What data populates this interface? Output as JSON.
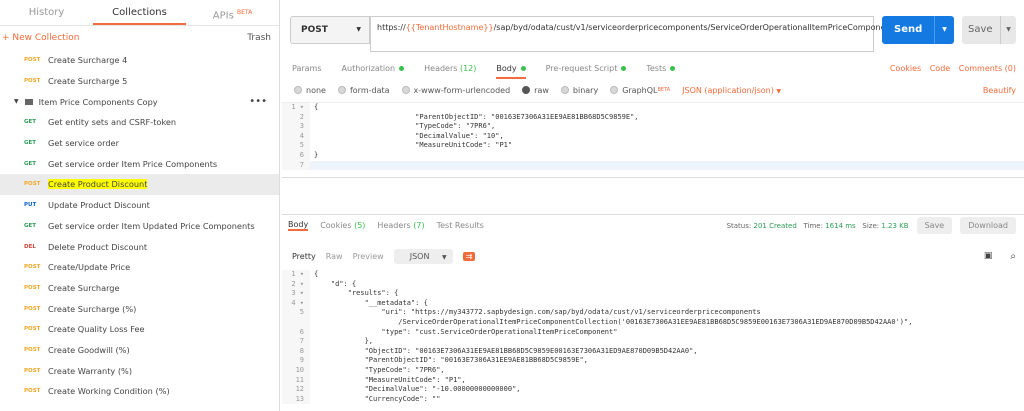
{
  "sidebar": {
    "tabs": [
      {
        "label": "History",
        "active": false
      },
      {
        "label": "Collections",
        "active": true
      },
      {
        "label": "APIs",
        "sup": "BETA",
        "active": false
      }
    ],
    "new_collection": "+ New Collection",
    "trash": "Trash",
    "items": [
      {
        "method": "POST",
        "label": "Create Surcharge 4"
      },
      {
        "method": "POST",
        "label": "Create Surcharge 5"
      },
      {
        "folder": true,
        "label": "Item Price Components Copy",
        "dots": "•••"
      },
      {
        "method": "GET",
        "label": "Get entity sets and CSRF-token"
      },
      {
        "method": "GET",
        "label": "Get service order"
      },
      {
        "method": "GET",
        "label": "Get service order Item Price Components"
      },
      {
        "method": "POST",
        "label": "Create Product Discount",
        "selected": true
      },
      {
        "method": "PUT",
        "label": "Update Product Discount"
      },
      {
        "method": "GET",
        "label": "Get service order Item Updated Price Components"
      },
      {
        "method": "DEL",
        "label": "Delete Product Discount"
      },
      {
        "method": "POST",
        "label": "Create/Update Price"
      },
      {
        "method": "POST",
        "label": "Create Surcharge"
      },
      {
        "method": "POST",
        "label": "Create Surcharge (%)"
      },
      {
        "method": "POST",
        "label": "Create Quality Loss Fee"
      },
      {
        "method": "POST",
        "label": "Create Goodwill (%)"
      },
      {
        "method": "POST",
        "label": "Create Warranty (%)"
      },
      {
        "method": "POST",
        "label": "Create Working Condition (%)"
      }
    ]
  },
  "request": {
    "method": "POST",
    "url_prefix": "https://",
    "url_var": "{{TenantHostname}}",
    "url_rest": "/sap/byd/odata/cust/v1/serviceorderpricecomponents/ServiceOrderOperationalItemPriceComponentCollection",
    "send": "Send",
    "save": "Save",
    "tabs": {
      "params": "Params",
      "auth": "Authorization",
      "headers": "Headers",
      "headers_count": "(12)",
      "body": "Body",
      "prereq": "Pre-request Script",
      "tests": "Tests"
    },
    "links": [
      "Cookies",
      "Code",
      "Comments (0)"
    ],
    "body_options": [
      "none",
      "form-data",
      "x-www-form-urlencoded",
      "raw",
      "binary",
      "GraphQL"
    ],
    "graphql_sup": "BETA",
    "content_type": "JSON (application/json)",
    "beautify": "Beautify",
    "body_lines": [
      {
        "n": "1 ▾",
        "t": "{"
      },
      {
        "n": "2",
        "t": "\t\t\t\"ParentObjectID\": \"00163E7306A31EE9AE81BB68D5C9859E\","
      },
      {
        "n": "3",
        "t": "\t\t\t\"TypeCode\": \"7PR6\","
      },
      {
        "n": "4",
        "t": "\t\t\t\"DecimalValue\": \"10\","
      },
      {
        "n": "5",
        "t": "\t\t\t\"MeasureUnitCode\": \"P1\""
      },
      {
        "n": "6",
        "t": "}"
      },
      {
        "n": "7",
        "t": ""
      }
    ]
  },
  "response": {
    "tabs": {
      "body": "Body",
      "cookies": "Cookies",
      "cookies_count": "(5)",
      "headers": "Headers",
      "headers_count": "(7)",
      "tests": "Test Results"
    },
    "status_label": "Status:",
    "status": "201 Created",
    "time_label": "Time:",
    "time": "1614 ms",
    "size_label": "Size:",
    "size": "1.23 KB",
    "save": "Save",
    "download": "Download",
    "view": {
      "pretty": "Pretty",
      "raw": "Raw",
      "preview": "Preview",
      "format": "JSON"
    },
    "lines": [
      {
        "n": "1 ▾",
        "t": "{"
      },
      {
        "n": "2 ▾",
        "t": "    \"d\": {"
      },
      {
        "n": "3 ▾",
        "t": "        \"results\": {"
      },
      {
        "n": "4 ▾",
        "t": "            \"__metadata\": {"
      },
      {
        "n": "5",
        "t": "                \"uri\": \"https://my343772.sapbydesign.com/sap/byd/odata/cust/v1/serviceorderpricecomponents"
      },
      {
        "n": "",
        "t": "                    /ServiceOrderOperationalItemPriceComponentCollection('00163E7306A31EE9AE81BB68D5C9859E00163E7306A31ED9AE870D09B5D42AA0')\","
      },
      {
        "n": "6",
        "t": "                \"type\": \"cust.ServiceOrderOperationalItemPriceComponent\""
      },
      {
        "n": "7",
        "t": "            },"
      },
      {
        "n": "8",
        "t": "            \"ObjectID\": \"00163E7306A31EE9AE81BB68D5C9859E00163E7306A31ED9AE870D09B5D42AA0\","
      },
      {
        "n": "9",
        "t": "            \"ParentObjectID\": \"00163E7306A31EE9AE81BB68D5C9859E\","
      },
      {
        "n": "10",
        "t": "            \"TypeCode\": \"7PR6\","
      },
      {
        "n": "11",
        "t": "            \"MeasureUnitCode\": \"P1\","
      },
      {
        "n": "12",
        "t": "            \"DecimalValue\": \"-10.00000000000000\","
      },
      {
        "n": "13",
        "t": "            \"CurrencyCode\": \"\""
      }
    ]
  }
}
